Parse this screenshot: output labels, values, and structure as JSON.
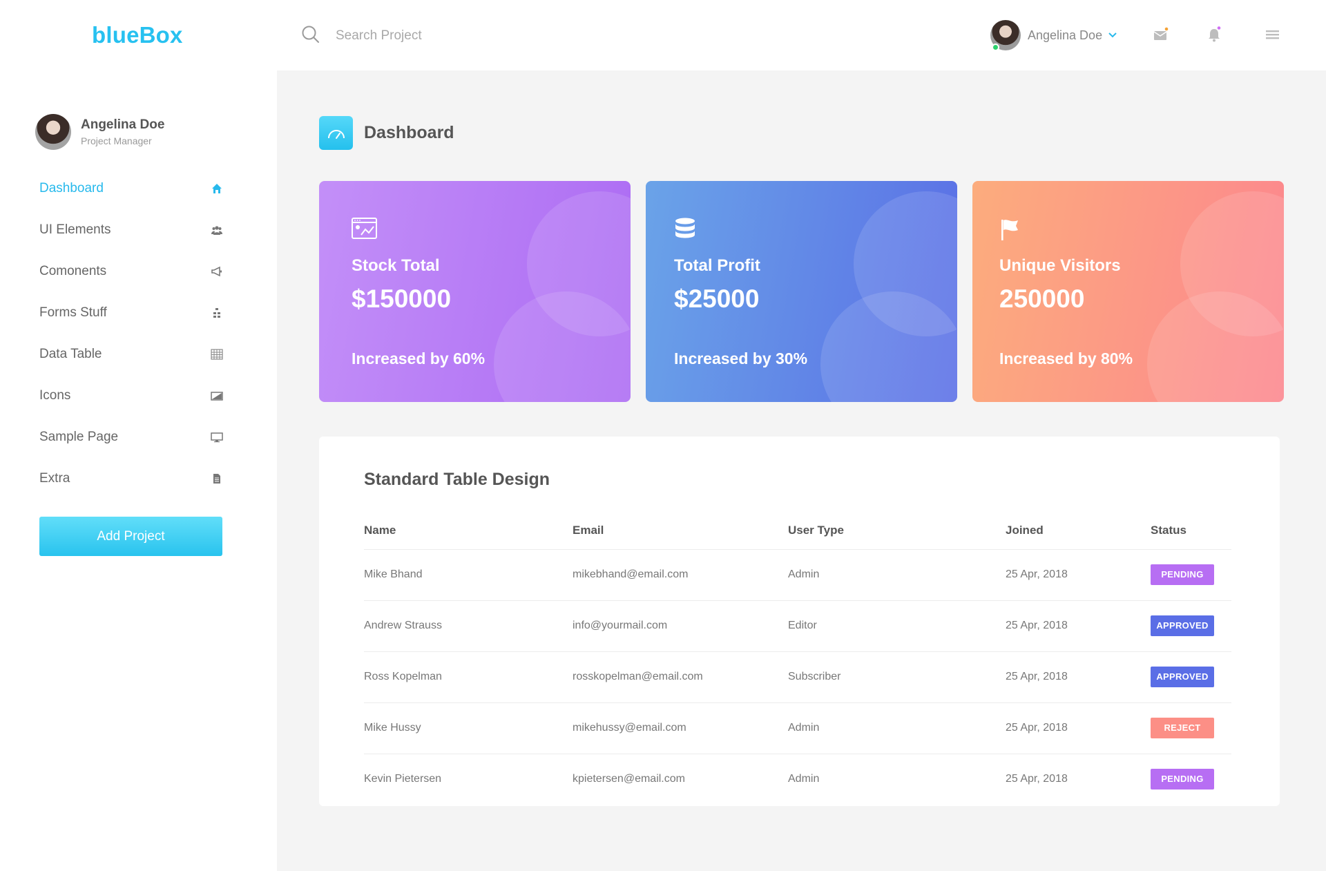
{
  "brand": "blueBox",
  "search": {
    "placeholder": "Search Project"
  },
  "top_user": {
    "name": "Angelina Doe"
  },
  "sidebar": {
    "profile": {
      "name": "Angelina Doe",
      "role": "Project Manager"
    },
    "items": [
      {
        "label": "Dashboard",
        "icon": "home-icon",
        "active": true
      },
      {
        "label": "UI Elements",
        "icon": "users-icon"
      },
      {
        "label": "Comonents",
        "icon": "megaphone-icon"
      },
      {
        "label": "Forms Stuff",
        "icon": "sitemap-icon"
      },
      {
        "label": "Data Table",
        "icon": "table-icon"
      },
      {
        "label": "Icons",
        "icon": "image-icon"
      },
      {
        "label": "Sample Page",
        "icon": "monitor-icon"
      },
      {
        "label": "Extra",
        "icon": "document-icon"
      }
    ],
    "add_button": "Add Project"
  },
  "page": {
    "title": "Dashboard"
  },
  "cards": [
    {
      "title": "Stock Total",
      "value": "$150000",
      "footer": "Increased by 60%",
      "icon": "chart-window-icon"
    },
    {
      "title": "Total Profit",
      "value": "$25000",
      "footer": "Increased by 30%",
      "icon": "database-icon"
    },
    {
      "title": "Unique Visitors",
      "value": "250000",
      "footer": "Increased by 80%",
      "icon": "flag-icon"
    }
  ],
  "table": {
    "title": "Standard Table Design",
    "headers": [
      "Name",
      "Email",
      "User Type",
      "Joined",
      "Status"
    ],
    "rows": [
      {
        "name": "Mike Bhand",
        "email": "mikebhand@email.com",
        "type": "Admin",
        "joined": "25 Apr, 2018",
        "status": "PENDING"
      },
      {
        "name": "Andrew Strauss",
        "email": "info@yourmail.com",
        "type": "Editor",
        "joined": "25 Apr, 2018",
        "status": "APPROVED"
      },
      {
        "name": "Ross Kopelman",
        "email": "rosskopelman@email.com",
        "type": "Subscriber",
        "joined": "25 Apr, 2018",
        "status": "APPROVED"
      },
      {
        "name": "Mike Hussy",
        "email": "mikehussy@email.com",
        "type": "Admin",
        "joined": "25 Apr, 2018",
        "status": "REJECT"
      },
      {
        "name": "Kevin Pietersen",
        "email": "kpietersen@email.com",
        "type": "Admin",
        "joined": "25 Apr, 2018",
        "status": "PENDING"
      }
    ]
  },
  "colors": {
    "accent": "#27c1f0",
    "pending": "#b76ef3",
    "approved": "#5a6ee6",
    "reject": "#fc8f86"
  }
}
